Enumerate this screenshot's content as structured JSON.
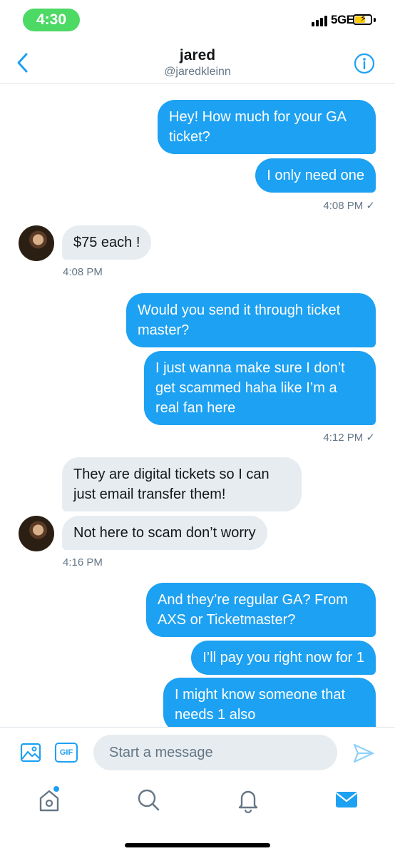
{
  "status": {
    "time": "4:30",
    "network": "5GE"
  },
  "header": {
    "name": "jared",
    "handle": "@jaredkleinn"
  },
  "messages": [
    {
      "side": "out",
      "text": "Hey! How much for your GA ticket?"
    },
    {
      "side": "out",
      "text": "I only need one"
    },
    {
      "side": "out_meta",
      "text": "4:08 PM ✓"
    },
    {
      "side": "in",
      "text": "$75 each !"
    },
    {
      "side": "in_meta",
      "text": "4:08 PM"
    },
    {
      "side": "out",
      "text": "Would you send it through ticket master?"
    },
    {
      "side": "out",
      "text": "I just wanna make sure I don’t get scammed haha like I’m a real fan here"
    },
    {
      "side": "out_meta",
      "text": "4:12 PM ✓"
    },
    {
      "side": "in",
      "text": "They are digital tickets so I can just email transfer them!"
    },
    {
      "side": "in",
      "text": "Not here to scam don’t worry"
    },
    {
      "side": "in_meta",
      "text": "4:16 PM"
    },
    {
      "side": "out",
      "text": "And they’re regular GA? From AXS or Ticketmaster?"
    },
    {
      "side": "out",
      "text": "I’ll pay you right now for 1"
    },
    {
      "side": "out",
      "text": "I might know someone that needs 1 also"
    }
  ],
  "composer": {
    "gif_label": "GIF",
    "placeholder": "Start a message"
  },
  "tabs": [
    "home-icon",
    "search-icon",
    "notifications-icon",
    "messages-icon"
  ],
  "colors": {
    "accent": "#1da1f2",
    "incoming_bubble": "#e6ecf0",
    "time_pill": "#4cd964"
  }
}
